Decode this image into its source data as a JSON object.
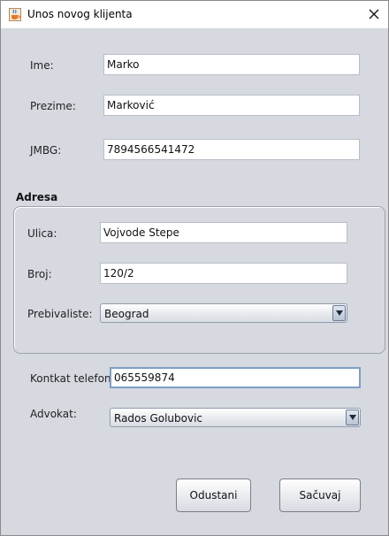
{
  "window": {
    "title": "Unos novog klijenta"
  },
  "form": {
    "ime": {
      "label": "Ime:",
      "value": "Marko"
    },
    "prezime": {
      "label": "Prezime:",
      "value": "Marković"
    },
    "jmbg": {
      "label": "JMBG:",
      "value": "7894566541472"
    },
    "adresa": {
      "title": "Adresa",
      "ulica": {
        "label": "Ulica:",
        "value": "Vojvode Stepe"
      },
      "broj": {
        "label": "Broj:",
        "value": "120/2"
      },
      "prebivaliste": {
        "label": "Prebivaliste:",
        "value": "Beograd"
      }
    },
    "telefon": {
      "label": "Kontkat telefon:",
      "value": "065559874"
    },
    "advokat": {
      "label": "Advokat:",
      "value": "Rados Golubovic"
    }
  },
  "buttons": {
    "cancel": "Odustani",
    "save": "Sačuvaj"
  },
  "icons": {
    "app": "java-cup-icon",
    "close": "close-icon",
    "dropdown": "chevron-down-icon"
  }
}
